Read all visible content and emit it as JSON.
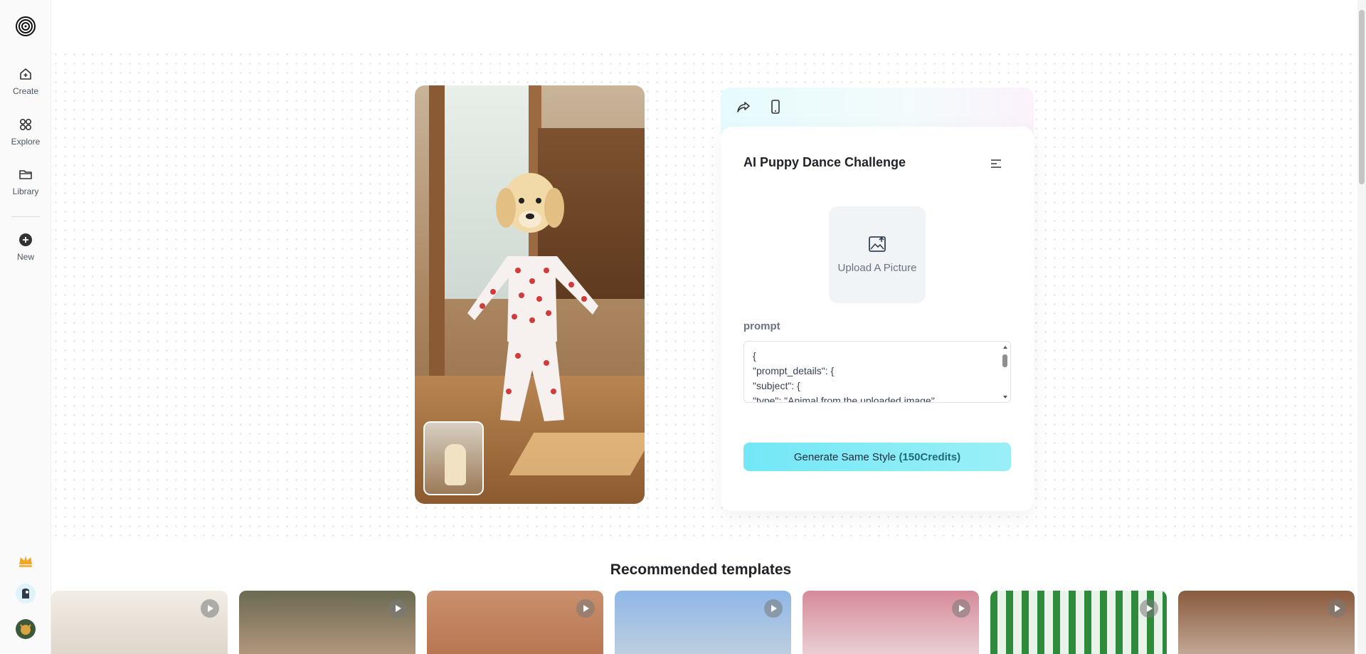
{
  "sidebar": {
    "items": [
      {
        "label": "Create",
        "icon": "create-icon"
      },
      {
        "label": "Explore",
        "icon": "explore-icon"
      },
      {
        "label": "Library",
        "icon": "library-icon"
      },
      {
        "label": "New",
        "icon": "plus-circle-icon"
      }
    ],
    "bottom_icons": [
      "crown-icon",
      "user-avatar",
      "profile-avatar"
    ]
  },
  "panel": {
    "title": "AI Puppy Dance Challenge",
    "upload_label": "Upload A Picture",
    "prompt_label": "prompt",
    "prompt_text": "{\n\"prompt_details\": {\n\"subject\": {\n\"type\": \"Animal from the uploaded image\",",
    "button_label": "Generate Same Style",
    "button_credits": "(150Credits)"
  },
  "recommended": {
    "title": "Recommended templates"
  },
  "colors": {
    "accent": "#73e7f6",
    "sidebar_bg": "#fafafa"
  }
}
